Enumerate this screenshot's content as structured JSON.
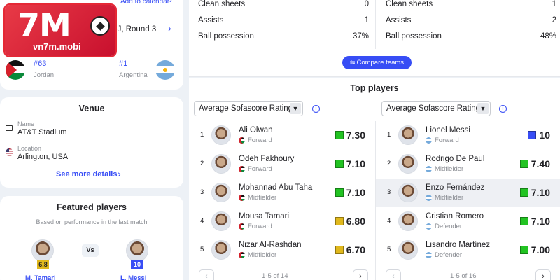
{
  "logo": {
    "main": "7M",
    "sub": "vn7m.mobi"
  },
  "match": {
    "add_calendar": "Add to calendar",
    "round": "p J, Round 3",
    "home": {
      "rank": "#63",
      "name": "Jordan"
    },
    "away": {
      "rank": "#1",
      "name": "Argentina"
    }
  },
  "venue": {
    "title": "Venue",
    "name_label": "Name",
    "name_value": "AT&T Stadium",
    "location_label": "Location",
    "location_value": "Arlington, USA",
    "see_more": "See more details"
  },
  "featured": {
    "title": "Featured players",
    "subtitle": "Based on performance in the last match",
    "vs": "Vs",
    "left": {
      "rating": "6.8",
      "name": "M. Tamari"
    },
    "right": {
      "rating": "10",
      "name": "L. Messi"
    }
  },
  "stats": {
    "left": [
      {
        "label": "Clean sheets",
        "value": "0"
      },
      {
        "label": "Assists",
        "value": "1"
      },
      {
        "label": "Ball possession",
        "value": "37%"
      }
    ],
    "right": [
      {
        "label": "Clean sheets",
        "value": "1"
      },
      {
        "label": "Assists",
        "value": "2"
      },
      {
        "label": "Ball possession",
        "value": "48%"
      }
    ],
    "compare_button": "Compare teams"
  },
  "top_players": {
    "title": "Top players",
    "dropdown_left": "Average Sofascore Rating",
    "dropdown_right": "Average Sofascore Rating",
    "left": [
      {
        "rank": "1",
        "name": "Ali Olwan",
        "position": "Forward",
        "rating": "7.30"
      },
      {
        "rank": "2",
        "name": "Odeh Fakhoury",
        "position": "Forward",
        "rating": "7.10"
      },
      {
        "rank": "3",
        "name": "Mohannad Abu Taha",
        "position": "Midfielder",
        "rating": "7.10"
      },
      {
        "rank": "4",
        "name": "Mousa Tamari",
        "position": "Forward",
        "rating": "6.80"
      },
      {
        "rank": "5",
        "name": "Nizar Al-Rashdan",
        "position": "Midfielder",
        "rating": "6.70"
      }
    ],
    "right": [
      {
        "rank": "1",
        "name": "Lionel Messi",
        "position": "Forward",
        "rating": "10"
      },
      {
        "rank": "2",
        "name": "Rodrigo De Paul",
        "position": "Midfielder",
        "rating": "7.40"
      },
      {
        "rank": "3",
        "name": "Enzo Fernández",
        "position": "Midfielder",
        "rating": "7.10"
      },
      {
        "rank": "4",
        "name": "Cristian Romero",
        "position": "Defender",
        "rating": "7.10"
      },
      {
        "rank": "5",
        "name": "Lisandro Martínez",
        "position": "Defender",
        "rating": "7.00"
      }
    ],
    "pager_left": "1-5 of 14",
    "pager_right": "1-5 of 16"
  },
  "colors": {
    "accent": "#374df5",
    "rating_green": "#22c322",
    "rating_yellow": "#e0b81c",
    "rating_blue": "#374df5",
    "logo_red": "#e52835"
  }
}
